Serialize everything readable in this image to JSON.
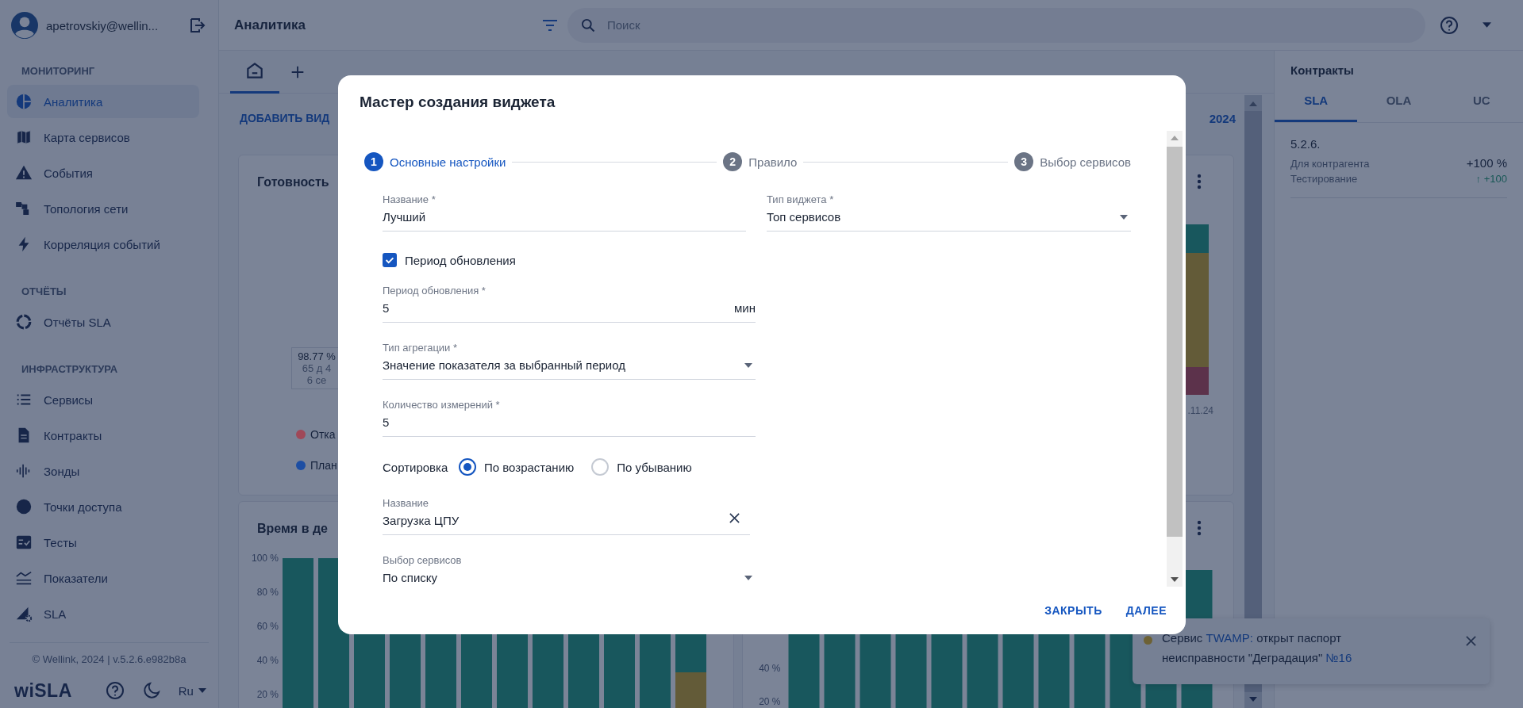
{
  "sidebar": {
    "user": "apetrovskiy@wellin...",
    "sections": [
      {
        "title": "МОНИТОРИНГ",
        "items": [
          {
            "label": "Аналитика",
            "selected": true
          },
          {
            "label": "Карта сервисов",
            "selected": false
          },
          {
            "label": "События",
            "selected": false
          },
          {
            "label": "Топология сети",
            "selected": false
          },
          {
            "label": "Корреляция событий",
            "selected": false
          }
        ]
      },
      {
        "title": "ОТЧЁТЫ",
        "items": [
          {
            "label": "Отчёты SLA",
            "selected": false
          }
        ]
      },
      {
        "title": "ИНФРАСТРУКТУРА",
        "items": [
          {
            "label": "Сервисы",
            "selected": false
          },
          {
            "label": "Контракты",
            "selected": false
          },
          {
            "label": "Зонды",
            "selected": false
          },
          {
            "label": "Точки доступа",
            "selected": false
          },
          {
            "label": "Тесты",
            "selected": false
          },
          {
            "label": "Показатели",
            "selected": false
          },
          {
            "label": "SLA",
            "selected": false
          }
        ]
      }
    ],
    "copyright": "© Wellink, 2024 | v.5.2.6.e982b8a",
    "logo": "wiSLA",
    "language": "Ru"
  },
  "header": {
    "title": "Аналитика",
    "search_placeholder": "Поиск"
  },
  "dashboard": {
    "tabs": [
      {
        "selected": true
      }
    ],
    "add_widget": "ДОБАВИТЬ ВИД",
    "period": "2024",
    "availability": {
      "title": "Готовность",
      "summary": [
        "98.77 %",
        "65 д 4",
        "6 се"
      ],
      "legend": [
        {
          "label": "Отка",
          "color": "#a04858"
        },
        {
          "label": "План",
          "color": "#1d4ea3"
        }
      ]
    },
    "status": {
      "date": ".11.24"
    },
    "downtime": {
      "title": "Время в де",
      "y_ticks": [
        "100 %",
        "80 %",
        "60 %",
        "40 %",
        "20 %"
      ]
    },
    "trend": {
      "y_ticks": [
        "40 %",
        "20 %"
      ]
    }
  },
  "contracts": {
    "title": "Контракты",
    "tabs": [
      {
        "label": "SLA",
        "selected": true
      },
      {
        "label": "OLA",
        "selected": false
      },
      {
        "label": "UC",
        "selected": false
      }
    ],
    "items": [
      {
        "name": "5.2.6.",
        "type": "Для контрагента",
        "value": "+100 %",
        "subtitle": "Тестирование",
        "change": "↑ +100"
      }
    ]
  },
  "notification": {
    "prefix": "Сервис",
    "service": "TWAMP:",
    "text": "открыт паспорт неисправности \"Деградация\"",
    "number": "№16"
  },
  "dialog": {
    "title": "Мастер создания виджета",
    "steps": [
      {
        "number": "1",
        "label": "Основные настройки",
        "selected": true
      },
      {
        "number": "2",
        "label": "Правило",
        "selected": false
      },
      {
        "number": "3",
        "label": "Выбор сервисов",
        "selected": false
      }
    ],
    "top_fields": [
      {
        "kind": "text",
        "label": "Название *",
        "value": "Лучший"
      },
      {
        "kind": "select",
        "label": "Тип виджета *",
        "value": "Топ сервисов"
      }
    ],
    "fields": [
      {
        "kind": "checkbox",
        "label": "Период обновления",
        "checked": true
      },
      {
        "kind": "text",
        "label": "Период обновления *",
        "value": "5",
        "suffix": "мин"
      },
      {
        "kind": "select",
        "label": "Тип агрегации *",
        "value": "Значение показателя за выбранный период"
      },
      {
        "kind": "text",
        "label": "Количество измерений *",
        "value": "5"
      },
      {
        "kind": "radio",
        "label": "Сортировка",
        "options": [
          {
            "label": "По возрастанию",
            "selected": true
          },
          {
            "label": "По убыванию",
            "selected": false
          }
        ]
      },
      {
        "kind": "clearable",
        "label": "Название",
        "value": "Загрузка ЦПУ"
      },
      {
        "kind": "select",
        "label": "Выбор сервисов",
        "value": "По списку"
      }
    ],
    "buttons": [
      "ЗАКРЫТЬ",
      "ДАЛЕЕ"
    ]
  }
}
